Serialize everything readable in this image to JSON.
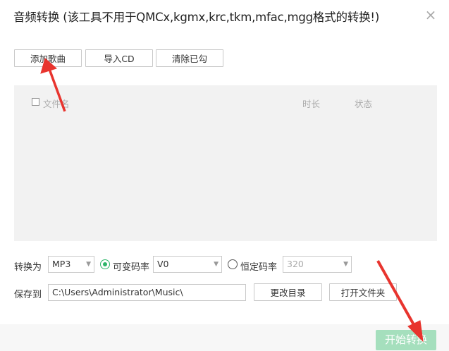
{
  "window": {
    "title": "音频转换 (该工具不用于QMCx,kgmx,krc,tkm,mfac,mgg格式的转换!)",
    "close_glyph": "×"
  },
  "toolbar": {
    "add_song": "添加歌曲",
    "import_cd": "导入CD",
    "clear_checked": "清除已勾"
  },
  "list": {
    "columns": {
      "filename": "文件名",
      "duration": "时长",
      "status": "状态"
    },
    "rows": []
  },
  "convert": {
    "label": "转换为",
    "format": "MP3",
    "vbr_label": "可变码率",
    "vbr_value": "V0",
    "vbr_selected": true,
    "cbr_label": "恒定码率",
    "cbr_value": "320",
    "cbr_selected": false
  },
  "save": {
    "label": "保存到",
    "path": "C:\\Users\\Administrator\\Music\\",
    "change_dir": "更改目录",
    "open_folder": "打开文件夹"
  },
  "actions": {
    "start": "开始转换"
  },
  "colors": {
    "accent": "#2fb56a",
    "start_button": "#a5dfbd",
    "annotation_arrow": "#e8342e"
  }
}
